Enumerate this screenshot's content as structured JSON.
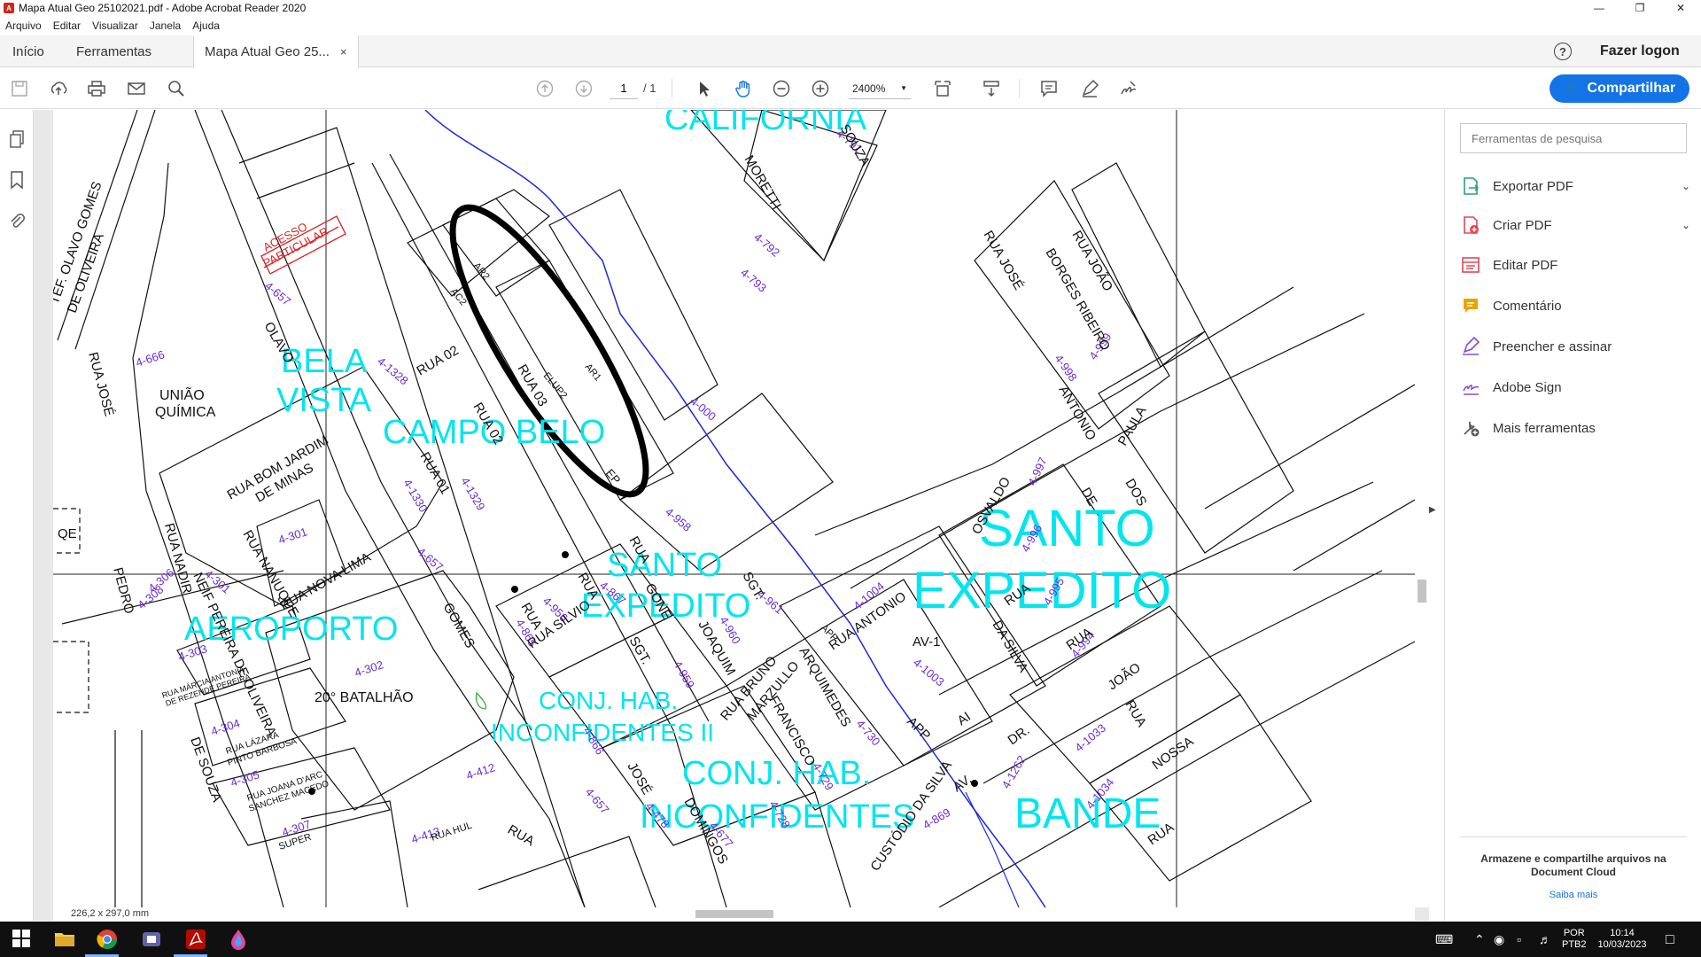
{
  "window": {
    "title": "Mapa Atual Geo 25102021.pdf - Adobe Acrobat Reader 2020",
    "controls": [
      "—",
      "❐",
      "✕"
    ]
  },
  "menu": [
    "Arquivo",
    "Editar",
    "Visualizar",
    "Janela",
    "Ajuda"
  ],
  "tabs": {
    "home": "Início",
    "tools": "Ferramentas",
    "doc": "Mapa Atual Geo 25...",
    "close": "×"
  },
  "header": {
    "help": "?",
    "login": "Fazer logon"
  },
  "toolbar": {
    "page_current": "1",
    "page_total": "/ 1",
    "zoom": "2400%",
    "share_label": "Compartilhar"
  },
  "status": {
    "dims": "226,2 x 297,0 mm"
  },
  "right_pane": {
    "search_placeholder": "Ferramentas de pesquisa",
    "tools": [
      {
        "label": "Exportar PDF",
        "color": "#2d9d78",
        "icon": "export-pdf-icon"
      },
      {
        "label": "Criar PDF",
        "color": "#e34850",
        "icon": "create-pdf-icon"
      },
      {
        "label": "Editar PDF",
        "color": "#e34850",
        "icon": "edit-pdf-icon"
      },
      {
        "label": "Comentário",
        "color": "#e9a400",
        "icon": "comment-icon"
      },
      {
        "label": "Preencher e assinar",
        "color": "#8b4bc8",
        "icon": "fill-sign-icon"
      },
      {
        "label": "Adobe Sign",
        "color": "#8b4bc8",
        "icon": "adobe-sign-icon"
      },
      {
        "label": "Mais ferramentas",
        "color": "#555555",
        "icon": "more-tools-icon"
      }
    ],
    "cloud_text": "Armazene e compartilhe arquivos na Document Cloud",
    "cloud_link": "Saiba mais"
  },
  "taskbar": {
    "lang1": "POR",
    "lang2": "PTB2",
    "time": "10:14",
    "date": "10/03/2023"
  },
  "map": {
    "districts": {
      "california": "CALIFORNIA",
      "bela": "BELA",
      "vista": "VISTA",
      "campo_belo": "CAMPO BELO",
      "santo_small": "SANTO",
      "expedito_small": "EXPEDITO",
      "santo_big": "SANTO",
      "expedito_big": "EXPEDITO",
      "aeroporto": "AEROPORTO",
      "conj1a": "CONJ. HAB.",
      "conj1b": "INCONFIDENTES II",
      "conj2a": "CONJ. HAB.",
      "conj2b": "INCONFIDENTES",
      "bande": "BANDE"
    },
    "places": {
      "uniao": "UNIÃO",
      "quimica": "QUÍMICA",
      "batalhao": "20° BATALHÃO",
      "acesso1": "ACESSO",
      "acesso2": "PARTICULAR",
      "qe": "QE",
      "av1": "AV-1",
      "ai": "AI",
      "app": "APP",
      "app2": "APP"
    },
    "parcels": {
      "p657a": "4-657",
      "p666": "4-666",
      "p1328": "4-1328",
      "p792": "4-792",
      "p793": "4-793",
      "p000": "4-000",
      "p999": "4-999",
      "p998": "4-998",
      "p997": "4-997",
      "p1330": "4-1330",
      "p1329": "4-1329",
      "p657b": "4-657",
      "p301a": "4-301",
      "p301b": "4-301",
      "p306": "4-306",
      "p308": "4-308",
      "p303": "4-303",
      "p302": "4-302",
      "p304": "4-304",
      "p305": "4-305",
      "p307": "4-307",
      "p958": "4-958",
      "p956": "4-956",
      "p865": "4-865",
      "p961": "4-961",
      "p960": "4-960",
      "p959": "4-959",
      "p866": "4-866",
      "p412": "4-412",
      "p413": "4-413",
      "p657c": "4-657",
      "p478": "4-478",
      "p677": "4-677",
      "p728": "4-728",
      "p729": "4-729",
      "p730": "4-730",
      "p869": "4-869",
      "p1003": "4-1003",
      "p1004": "4-1004",
      "p1262": "4-1262",
      "p1033": "4-1033",
      "p1034": "4-1034",
      "p994": "4-994",
      "p995": "4-995",
      "p996": "4-996",
      "p791": "4-791",
      "p657d": "4-657",
      "p867": "4-867"
    },
    "streets": {
      "olavo_gomes": "TEF. OLAVO GOMES",
      "de_oliveira": "DE OLIVEIRA",
      "rua_jose": "RUA JOSÉ",
      "pedro": "PEDRO",
      "olavo": "OLAVO",
      "gomes": "GOMES",
      "rua01": "RUA 01",
      "rua02a": "RUA 02",
      "rua02b": "RUA 02",
      "rua03": "RUA 03",
      "rua_bom_jardim": "RUA BOM JARDIM",
      "de_minas": "DE MINAS",
      "rua_nanuque": "RUA NANUQUE",
      "rua_nova_lima": "RUA NOVA LIMA",
      "rua_nadir": "RUA NADIR",
      "neif_pereira": "NEIF PEREIRA DE OLIVEIRA",
      "rua_silvio": "RUA SILVIO",
      "sgt1": "SGT.",
      "joaquim": "JOAQUIM",
      "rua_bruno": "RUA BRUNO",
      "marzullo": "MARZULLO",
      "sgt2": "SGT.",
      "arquimedes": "ARQUIMEDES",
      "francisco": "FRANCISCO",
      "custodio": "CUSTÓDIO DA SILVA",
      "av": "AV.",
      "dr": "DR.",
      "rua_antonio": "RUA ANTONIO",
      "moretti": "MORETTI",
      "souza": "SOUZA",
      "rua_jose2": "RUA JOSÉ",
      "rua_joao": "RUA JOÃO",
      "borges_ribeiro": "BORGES RIBEIRO",
      "antonio": "ANTONIO",
      "paula": "PAULA",
      "dos": "DOS",
      "de": "DE",
      "osvaldo": "OSVALDO",
      "rua": "RUA",
      "da_silva": "DA SILVA",
      "joao": "JOÃO",
      "rua2": "RUA",
      "nossa": "NOSSA",
      "rua3": "RUA",
      "rua4": "RUA",
      "de_souza": "DE SOUZA",
      "rua_joana": "RUA JOANA D'ARC",
      "sanchez": "SANCHEZ MACEDO",
      "rua_lazara": "RUA LÁZARA",
      "pinto_barbosa": "PINTO BARBOSA",
      "rua_marcia": "RUA MÁRCIA ANTONIA",
      "de_rezende": "DE REZENDE PEREIRA",
      "jose": "JOSÉ",
      "domingos": "DOMINGOS",
      "rua_hul": "RUA HUL",
      "rua5": "RUA",
      "super": "SUPER",
      "elup2": "ELUP2",
      "ar1": "AR1",
      "ar2": "AR2",
      "ac2": "AC2",
      "ep": "EP",
      "gone": "GONE",
      "rua6": "RUA",
      "rua7": "RUA",
      "rua8": "RUA"
    }
  }
}
